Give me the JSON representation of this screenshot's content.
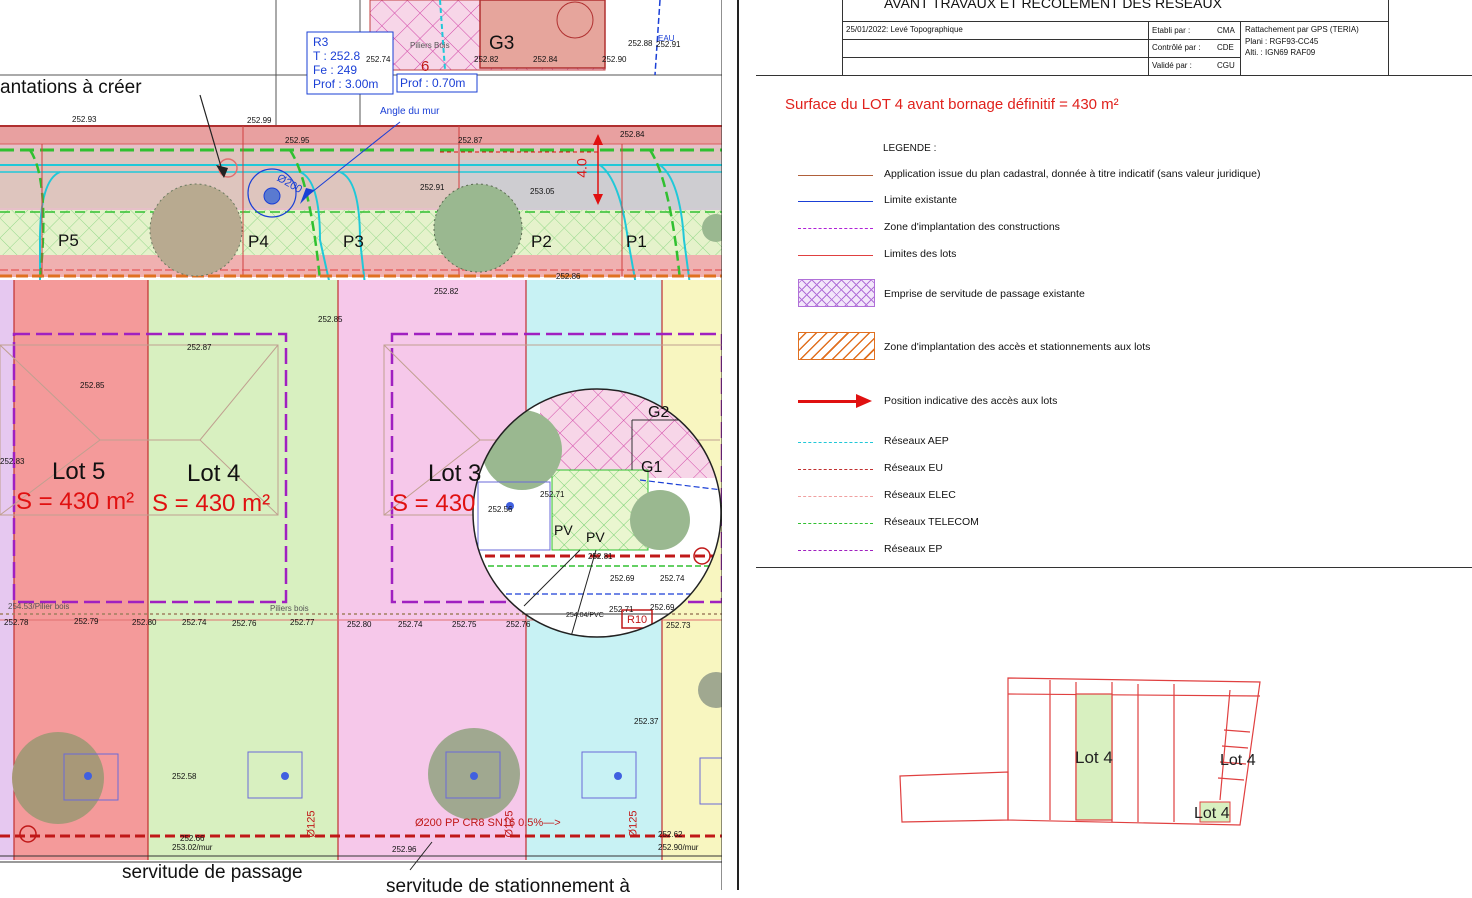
{
  "plan": {
    "top_label": "antations à créer",
    "r3_box": {
      "line1": "R3",
      "line2": "T : 252.8",
      "line3": "Fe : 249",
      "line4": "Prof : 3.00m"
    },
    "prof_box": "Prof : 0.70m",
    "angle_label": "Angle du mur",
    "pipe_label": "Ø200",
    "piliers_top": "Piliers Bois",
    "piliers_mid": "Piliers bois",
    "pilier_left": "254.53/Pilier bois",
    "g3": "G3",
    "g3_num": "6",
    "eau": "EAU",
    "lot5_name": "Lot 5",
    "lot5_area": "S =  430 m²",
    "lot4_name": "Lot 4",
    "lot4_area": "S =  430 m²",
    "lot3_name": "Lot 3",
    "lot3_area": "S =  430",
    "p5": "P5",
    "p4": "P4",
    "p3": "P3",
    "p2": "P2",
    "p1": "P1",
    "dim_vertical": "4.0",
    "bottom_pipe": "Ø200 PP CR8 SN16 0.5%—>",
    "servitude": "servitude de passage",
    "servitude2": "servitude de stationnement à",
    "mur1": "253.02/mur",
    "mur2": "252.90/mur",
    "pipe_125": "Ø125",
    "inset": {
      "g2": "G2",
      "g1": "G1",
      "pv1": "PV",
      "pv2": "PV",
      "r10": "R10",
      "pvc": "254.04/PVC"
    },
    "levels": {
      "l1": "252.93",
      "l2": "252.99",
      "l3": "252.95",
      "l4": "252.87",
      "l5": "252.84",
      "l6": "252.91",
      "l7": "253.05",
      "l8": "252.82",
      "l9": "252.86",
      "l10": "252.85",
      "l11": "252.87",
      "l12": "252.85",
      "l13": "252.83",
      "l14": "252.56",
      "r1": "252.78",
      "r2": "252.79",
      "r3": "252.80",
      "r4": "252.74",
      "r5": "252.76",
      "r6": "252.77",
      "r7": "252.80",
      "r8": "252.74",
      "r9": "252.75",
      "r10": "252.76",
      "r11": "252.73",
      "b1": "252.58",
      "b2": "252.37",
      "b3": "252.96",
      "b4": "252.62",
      "b5": "252.66",
      "t1": "252.74",
      "t2": "252.82",
      "t3": "252.84",
      "t4": "252.88",
      "t5": "252.91",
      "t6": "252.90",
      "i1": "252.71",
      "i2": "252.69",
      "i3": "252.71",
      "i4": "252.74",
      "i5": "252.69",
      "i6": "252.81"
    }
  },
  "header": {
    "title": "AVANT TRAVAUX ET RECOLEMENT DES RESEAUX",
    "date_row": "25/01/2022: Levé Topographique",
    "etabli": "Etabli par :",
    "etabli_v": "CMA",
    "controle": "Contrôlé par :",
    "controle_v": "CDE",
    "valide": "Validé par :",
    "valide_v": "CGU",
    "ratt1": "Rattachement par GPS (TERIA)",
    "ratt2": "Plani : RGF93-CC45",
    "ratt3": "Alti. : IGN69 RAF09"
  },
  "surface": "Surface du LOT 4 avant bornage définitif = 430 m²",
  "legend": {
    "title": "LEGENDE :",
    "items": [
      {
        "label": "Application issue du plan cadastral, donnée à titre indicatif (sans valeur juridique)",
        "color": "#b0603a"
      },
      {
        "label": "Limite existante",
        "color": "#1a3fd6"
      },
      {
        "label": "Zone d'implantation des constructions",
        "color": "#b020d8"
      },
      {
        "label": "Limites des lots",
        "color": "#e04040"
      },
      {
        "label": "Emprise de servitude de passage existante",
        "color": "#b070d8"
      },
      {
        "label": "Zone d'implantation des accès et stationnements aux lots",
        "color": "#e07020"
      },
      {
        "label": "Position indicative des accès aux lots",
        "color": "#e01010"
      },
      {
        "label": "Réseaux AEP",
        "color": "#20c8d8"
      },
      {
        "label": "Réseaux EU",
        "color": "#c03030"
      },
      {
        "label": "Réseaux ELEC",
        "color": "#f0a0a0"
      },
      {
        "label": "Réseaux TELECOM",
        "color": "#30c030"
      },
      {
        "label": "Réseaux EP",
        "color": "#a020c0"
      }
    ]
  },
  "mini": {
    "lot4_a": "Lot 4",
    "lot4_b": "Lot 4",
    "lot4_c": "Lot 4"
  }
}
